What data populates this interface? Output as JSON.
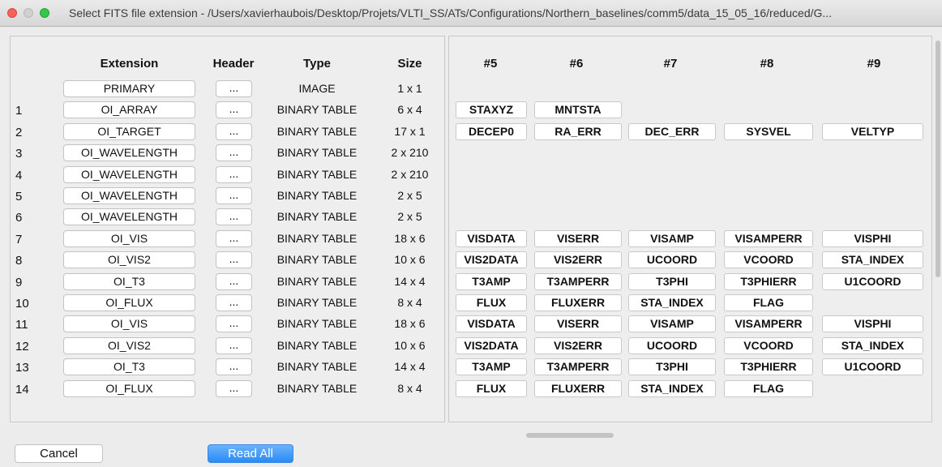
{
  "window": {
    "title": "Select FITS file extension - /Users/xavierhaubois/Desktop/Projets/VLTI_SS/ATs/Configurations/Northern_baselines/comm5/data_15_05_16/reduced/G..."
  },
  "left_table": {
    "headers": [
      "Extension",
      "Header",
      "Type",
      "Size"
    ],
    "header_button_label": "...",
    "rows": [
      {
        "num": "",
        "ext": "PRIMARY",
        "type": "IMAGE",
        "size": "1 x 1"
      },
      {
        "num": "1",
        "ext": "OI_ARRAY",
        "type": "BINARY TABLE",
        "size": "6 x 4"
      },
      {
        "num": "2",
        "ext": "OI_TARGET",
        "type": "BINARY TABLE",
        "size": "17 x 1"
      },
      {
        "num": "3",
        "ext": "OI_WAVELENGTH",
        "type": "BINARY TABLE",
        "size": "2 x 210"
      },
      {
        "num": "4",
        "ext": "OI_WAVELENGTH",
        "type": "BINARY TABLE",
        "size": "2 x 210"
      },
      {
        "num": "5",
        "ext": "OI_WAVELENGTH",
        "type": "BINARY TABLE",
        "size": "2 x 5"
      },
      {
        "num": "6",
        "ext": "OI_WAVELENGTH",
        "type": "BINARY TABLE",
        "size": "2 x 5"
      },
      {
        "num": "7",
        "ext": "OI_VIS",
        "type": "BINARY TABLE",
        "size": "18 x 6"
      },
      {
        "num": "8",
        "ext": "OI_VIS2",
        "type": "BINARY TABLE",
        "size": "10 x 6"
      },
      {
        "num": "9",
        "ext": "OI_T3",
        "type": "BINARY TABLE",
        "size": "14 x 4"
      },
      {
        "num": "10",
        "ext": "OI_FLUX",
        "type": "BINARY TABLE",
        "size": "8 x 4"
      },
      {
        "num": "11",
        "ext": "OI_VIS",
        "type": "BINARY TABLE",
        "size": "18 x 6"
      },
      {
        "num": "12",
        "ext": "OI_VIS2",
        "type": "BINARY TABLE",
        "size": "10 x 6"
      },
      {
        "num": "13",
        "ext": "OI_T3",
        "type": "BINARY TABLE",
        "size": "14 x 4"
      },
      {
        "num": "14",
        "ext": "OI_FLUX",
        "type": "BINARY TABLE",
        "size": "8 x 4"
      }
    ]
  },
  "right_table": {
    "headers": [
      "#5",
      "#6",
      "#7",
      "#8",
      "#9"
    ],
    "rows": [
      [],
      [
        "STAXYZ",
        "MNTSTA"
      ],
      [
        "DECEP0",
        "RA_ERR",
        "DEC_ERR",
        "SYSVEL",
        "VELTYP"
      ],
      [],
      [],
      [],
      [],
      [
        "VISDATA",
        "VISERR",
        "VISAMP",
        "VISAMPERR",
        "VISPHI"
      ],
      [
        "VIS2DATA",
        "VIS2ERR",
        "UCOORD",
        "VCOORD",
        "STA_INDEX"
      ],
      [
        "T3AMP",
        "T3AMPERR",
        "T3PHI",
        "T3PHIERR",
        "U1COORD"
      ],
      [
        "FLUX",
        "FLUXERR",
        "STA_INDEX",
        "FLAG"
      ],
      [
        "VISDATA",
        "VISERR",
        "VISAMP",
        "VISAMPERR",
        "VISPHI"
      ],
      [
        "VIS2DATA",
        "VIS2ERR",
        "UCOORD",
        "VCOORD",
        "STA_INDEX"
      ],
      [
        "T3AMP",
        "T3AMPERR",
        "T3PHI",
        "T3PHIERR",
        "U1COORD"
      ],
      [
        "FLUX",
        "FLUXERR",
        "STA_INDEX",
        "FLAG"
      ]
    ]
  },
  "footer": {
    "cancel_label": "Cancel",
    "read_all_label": "Read All"
  },
  "colors": {
    "primary_button": "#2a8af6",
    "close_light": "#fc605c",
    "zoom_light": "#34c84a"
  }
}
